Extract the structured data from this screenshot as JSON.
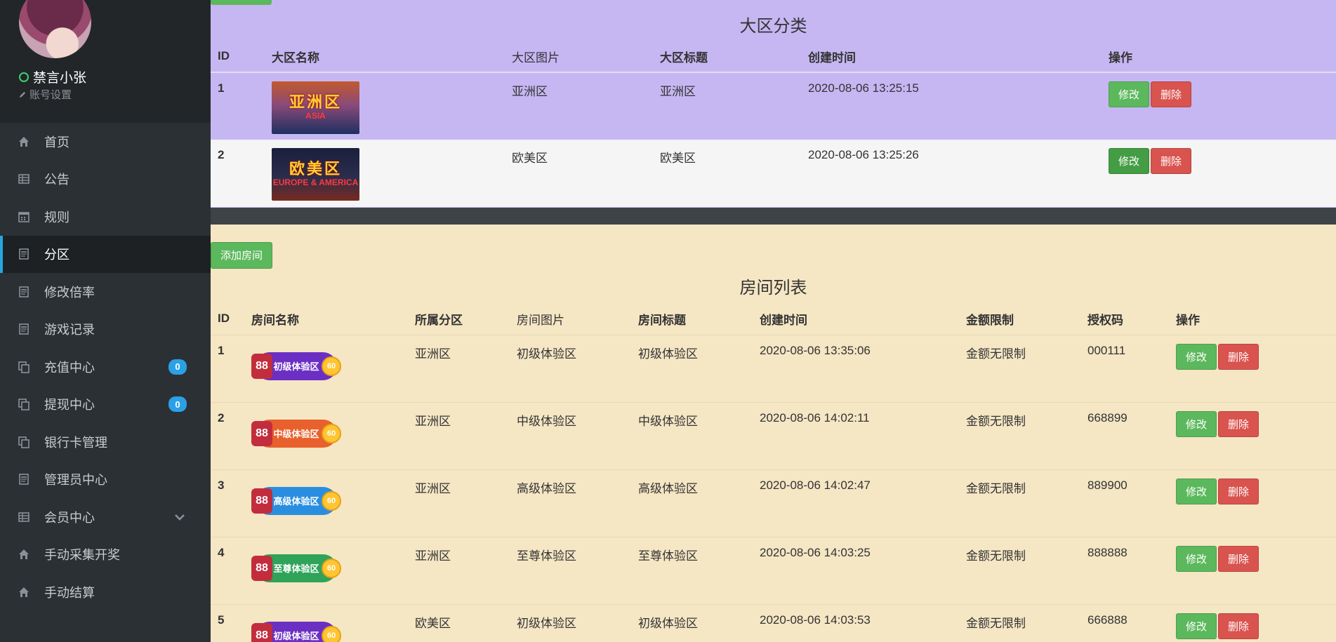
{
  "user": {
    "name": "禁言小张",
    "settings": "账号设置"
  },
  "menu": [
    {
      "label": "首页",
      "icon": "home-icon"
    },
    {
      "label": "公告",
      "icon": "grid-icon"
    },
    {
      "label": "规则",
      "icon": "calendar-icon"
    },
    {
      "label": "分区",
      "icon": "document-icon",
      "active": true
    },
    {
      "label": "修改倍率",
      "icon": "document-icon"
    },
    {
      "label": "游戏记录",
      "icon": "document-icon"
    },
    {
      "label": "充值中心",
      "icon": "copy-icon",
      "badge": "0"
    },
    {
      "label": "提现中心",
      "icon": "copy-icon",
      "badge": "0"
    },
    {
      "label": "银行卡管理",
      "icon": "copy-icon"
    },
    {
      "label": "管理员中心",
      "icon": "document-icon"
    },
    {
      "label": "会员中心",
      "icon": "grid-icon",
      "chevron": true
    },
    {
      "label": "手动采集开奖",
      "icon": "home-icon"
    },
    {
      "label": "手动结算",
      "icon": "home-icon"
    }
  ],
  "region": {
    "title": "大区分类",
    "headers": {
      "id": "ID",
      "name": "大区名称",
      "image": "大区图片",
      "label": "大区标题",
      "created": "创建时间",
      "action": "操作"
    },
    "rows": [
      {
        "id": "1",
        "image_text": "亚洲区",
        "image_sub": "ASIA",
        "name": "亚洲区",
        "label": "亚洲区",
        "created": "2020-08-06 13:25:15"
      },
      {
        "id": "2",
        "image_text": "欧美区",
        "image_sub": "EUROPE & AMERICA",
        "name": "欧美区",
        "label": "欧美区",
        "created": "2020-08-06 13:25:26"
      }
    ]
  },
  "buttons": {
    "edit": "修改",
    "delete": "删除",
    "add_room": "添加房间"
  },
  "rooms": {
    "title": "房间列表",
    "headers": {
      "id": "ID",
      "name": "房间名称",
      "zone": "所属分区",
      "image": "房间图片",
      "label": "房间标题",
      "created": "创建时间",
      "limit": "金额限制",
      "code": "授权码",
      "action": "操作"
    },
    "rows": [
      {
        "id": "1",
        "badge": "初级体验区",
        "zone": "亚洲区",
        "image": "初级体验区",
        "label": "初级体验区",
        "created": "2020-08-06 13:35:06",
        "limit": "金额无限制",
        "code": "000111",
        "color": "#6b2fc4"
      },
      {
        "id": "2",
        "badge": "中级体验区",
        "zone": "亚洲区",
        "image": "中级体验区",
        "label": "中级体验区",
        "created": "2020-08-06 14:02:11",
        "limit": "金额无限制",
        "code": "668899",
        "color": "#e8602c"
      },
      {
        "id": "3",
        "badge": "高级体验区",
        "zone": "亚洲区",
        "image": "高级体验区",
        "label": "高级体验区",
        "created": "2020-08-06 14:02:47",
        "limit": "金额无限制",
        "code": "889900",
        "color": "#2a8ee0"
      },
      {
        "id": "4",
        "badge": "至尊体验区",
        "zone": "亚洲区",
        "image": "至尊体验区",
        "label": "至尊体验区",
        "created": "2020-08-06 14:03:25",
        "limit": "金额无限制",
        "code": "888888",
        "color": "#2fa35a"
      },
      {
        "id": "5",
        "badge": "初级体验区",
        "zone": "欧美区",
        "image": "初级体验区",
        "label": "初级体验区",
        "created": "2020-08-06 14:03:53",
        "limit": "金额无限制",
        "code": "666888",
        "color": "#6b2fc4"
      }
    ]
  }
}
